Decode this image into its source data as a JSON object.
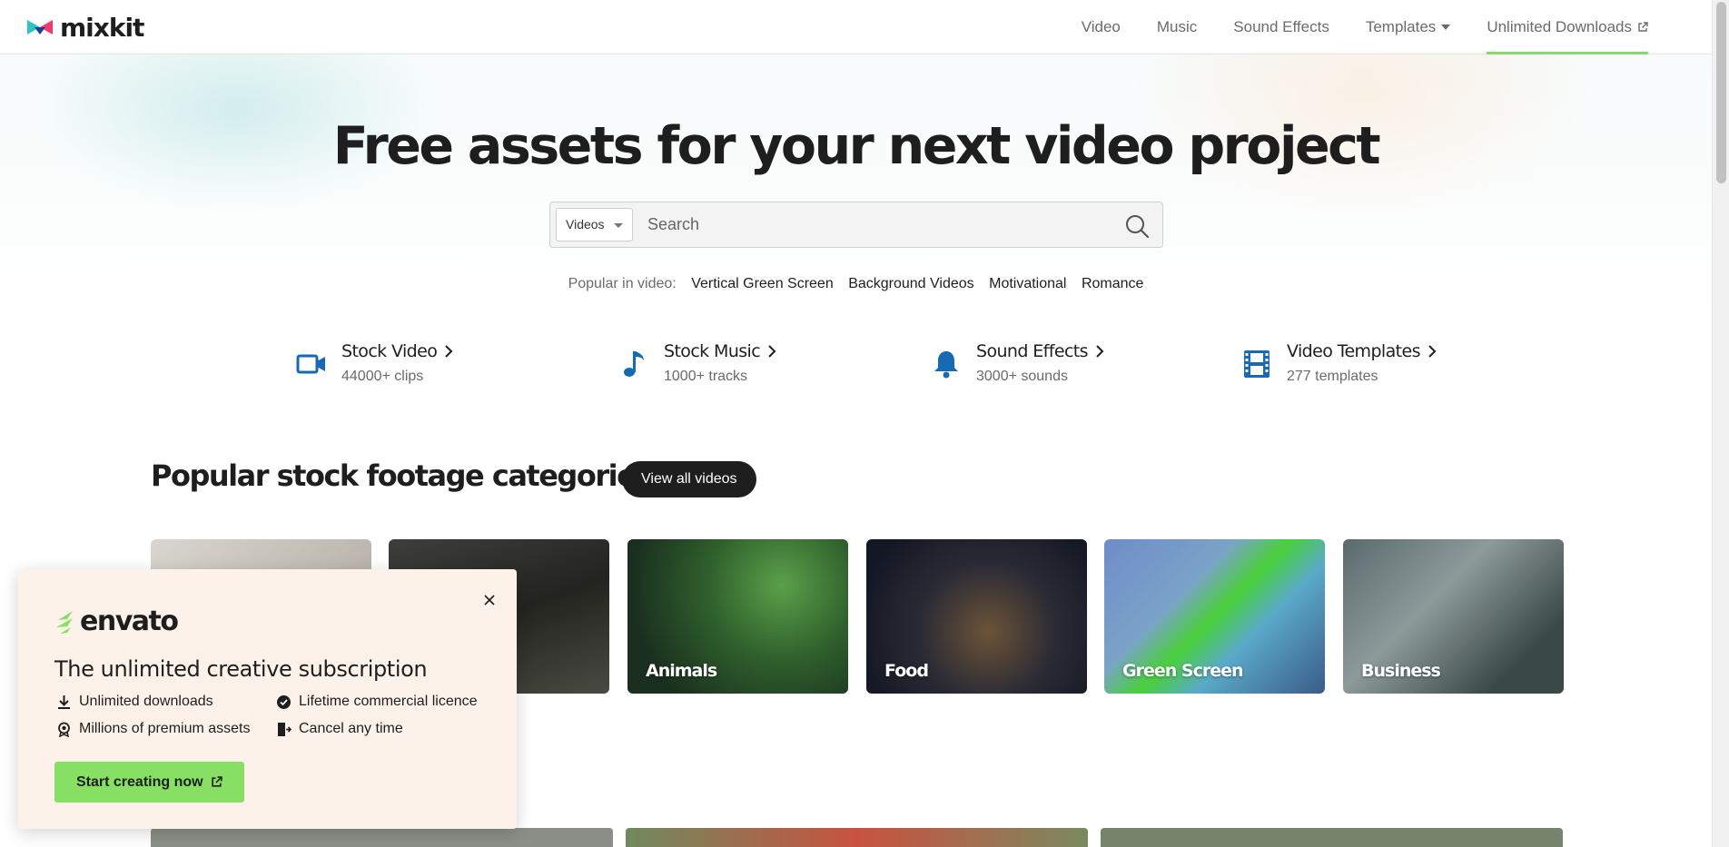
{
  "header": {
    "logo_text": "mixkit",
    "nav": [
      {
        "label": "Video"
      },
      {
        "label": "Music"
      },
      {
        "label": "Sound Effects"
      },
      {
        "label": "Templates"
      },
      {
        "label": "Unlimited Downloads"
      }
    ]
  },
  "hero": {
    "title": "Free assets for your next video project",
    "search": {
      "category": "Videos",
      "placeholder": "Search"
    },
    "popular_label": "Popular in video:",
    "popular_links": [
      "Vertical Green Screen",
      "Background Videos",
      "Motivational",
      "Romance"
    ]
  },
  "categories": [
    {
      "title": "Stock Video",
      "count": "44000+ clips",
      "icon": "video-camera-icon"
    },
    {
      "title": "Stock Music",
      "count": "1000+ tracks",
      "icon": "music-note-icon"
    },
    {
      "title": "Sound Effects",
      "count": "3000+ sounds",
      "icon": "bell-icon"
    },
    {
      "title": "Video Templates",
      "count": "277 templates",
      "icon": "film-strip-icon"
    }
  ],
  "section": {
    "title": "Popular stock footage categories",
    "view_all_label": "View all videos",
    "tiles": [
      {
        "label": ""
      },
      {
        "label": ""
      },
      {
        "label": "Animals"
      },
      {
        "label": "Food"
      },
      {
        "label": "Green Screen"
      },
      {
        "label": "Business"
      }
    ]
  },
  "popup": {
    "brand": "envato",
    "title": "The unlimited creative subscription",
    "features": [
      "Unlimited downloads",
      "Lifetime commercial licence",
      "Millions of premium assets",
      "Cancel any time"
    ],
    "cta_label": "Start creating now"
  },
  "colors": {
    "accent_green": "#86d96b",
    "cta_green": "#87e064",
    "icon_blue": "#1769b3",
    "dark": "#1e1e1e",
    "popup_bg": "#fdf2ea"
  }
}
